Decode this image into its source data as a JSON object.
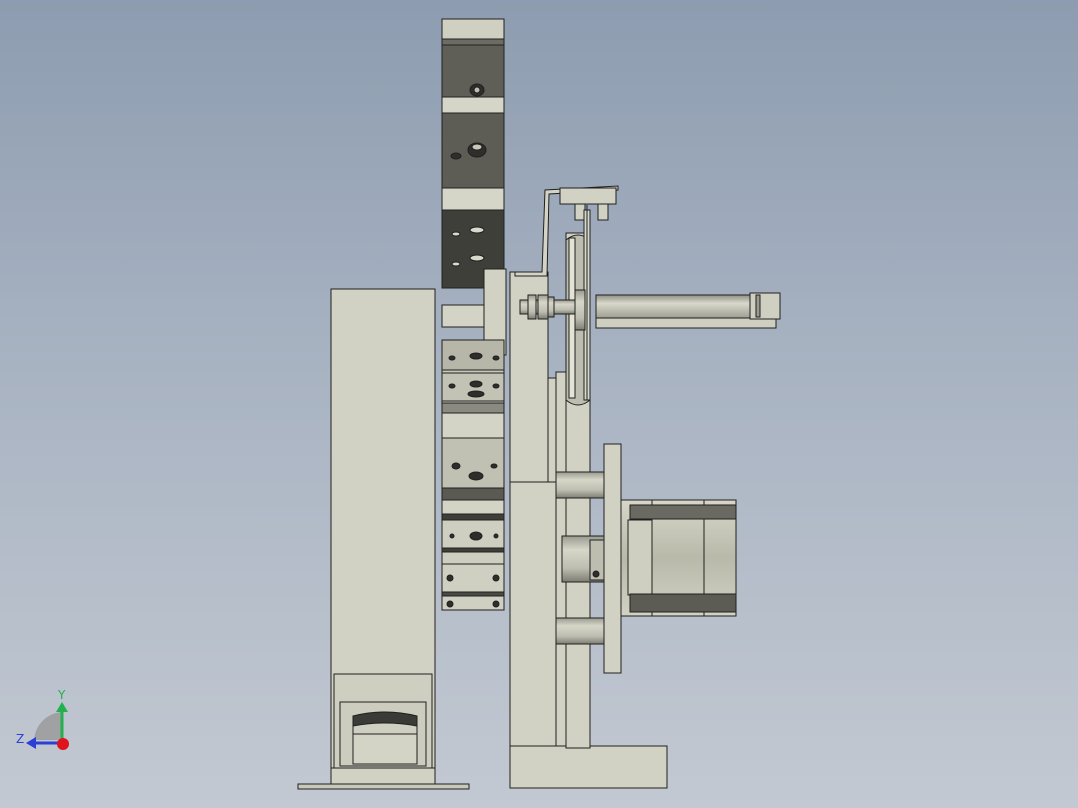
{
  "viewport": {
    "background_top": "#8d9cb0",
    "background_bottom": "#c3c9d2",
    "part_fill": "#d2d2c4",
    "edge_color": "#202020"
  },
  "triad": {
    "y_label": "Y",
    "z_label": "Z",
    "y_color": "#22b14c",
    "z_color": "#2a3fd6",
    "origin_color": "#e0141e"
  },
  "model": {
    "icon": "cad-side-view-assembly"
  }
}
